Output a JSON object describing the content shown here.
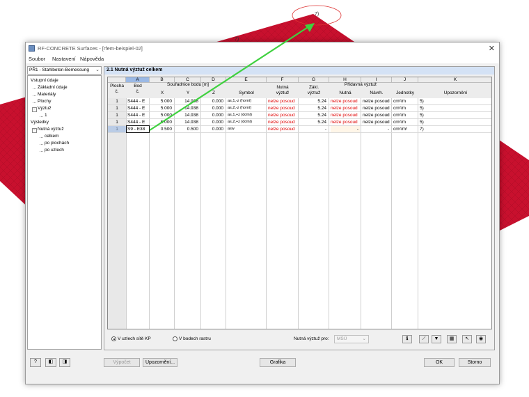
{
  "background": {
    "node_labels": [
      "7)",
      "7)"
    ]
  },
  "window": {
    "title": "RF-CONCRETE Surfaces - [rfem-beispiel-02]",
    "close_glyph": "✕",
    "menu": [
      "Soubor",
      "Nastavení",
      "Nápověda"
    ]
  },
  "case_select": {
    "value": "PŘ1 - Stahlbeton-Bemessung"
  },
  "navigator": {
    "items": [
      {
        "label": "Vstupní údaje",
        "level": 0,
        "toggle": ""
      },
      {
        "label": "Základní údaje",
        "level": 1,
        "toggle": ""
      },
      {
        "label": "Materiály",
        "level": 1,
        "toggle": ""
      },
      {
        "label": "Plochy",
        "level": 1,
        "toggle": ""
      },
      {
        "label": "Výztuž",
        "level": 1,
        "toggle": "−"
      },
      {
        "label": "1",
        "level": 2,
        "toggle": ""
      },
      {
        "label": "Výsledky",
        "level": 0,
        "toggle": ""
      },
      {
        "label": "Nutná výztuž",
        "level": 1,
        "toggle": "−"
      },
      {
        "label": "celkem",
        "level": 2,
        "toggle": ""
      },
      {
        "label": "po plochách",
        "level": 2,
        "toggle": ""
      },
      {
        "label": "po uzlech",
        "level": 2,
        "toggle": ""
      }
    ]
  },
  "panel": {
    "title": "2.1 Nutná výztuž celkem"
  },
  "table": {
    "column_letters": [
      "A",
      "B",
      "C",
      "D",
      "E",
      "F",
      "G",
      "H",
      "I",
      "J",
      "K"
    ],
    "selected_letter": "A",
    "header": {
      "plocha_1": "Plocha",
      "plocha_2": "č.",
      "bod_1": "Bod",
      "bod_2": "č.",
      "coords_group": "Souřadnice bodu [m]",
      "x": "X",
      "y": "Y",
      "z": "Z",
      "symbol": "Symbol",
      "nutna_1": "Nutná",
      "nutna_2": "výztuž",
      "zakl_1": "Zákl.",
      "zakl_2": "výztuž",
      "pridavna_group": "Přídavná výztuž",
      "pridavna_nutna": "Nutná",
      "pridavna_navrh": "Návrh.",
      "jednotky": "Jednotky",
      "upozorneni": "Upozornění"
    },
    "rows": [
      {
        "plocha": "1",
        "bod": "S444 - E",
        "x": "5.000",
        "y": "14.938",
        "z": "0.000",
        "symbol": "as,1,-z (horní)",
        "nutna": "nelze posoud",
        "zakl": "5.24",
        "pnutna": "nelze posoud",
        "navrh": "nelze posoud",
        "unit": "cm²/m",
        "warn": "5)"
      },
      {
        "plocha": "1",
        "bod": "S444 - E",
        "x": "5.000",
        "y": "14.938",
        "z": "0.000",
        "symbol": "as,2,-z (horní)",
        "nutna": "nelze posoud",
        "zakl": "5.24",
        "pnutna": "nelze posoud",
        "navrh": "nelze posoud",
        "unit": "cm²/m",
        "warn": "5)"
      },
      {
        "plocha": "1",
        "bod": "S444 - E",
        "x": "5.000",
        "y": "14.938",
        "z": "0.000",
        "symbol": "as,1,+z (dolní)",
        "nutna": "nelze posoud",
        "zakl": "5.24",
        "pnutna": "nelze posoud",
        "navrh": "nelze posoud",
        "unit": "cm²/m",
        "warn": "5)"
      },
      {
        "plocha": "1",
        "bod": "S444 - E",
        "x": "5.000",
        "y": "14.938",
        "z": "0.000",
        "symbol": "as,2,+z (dolní)",
        "nutna": "nelze posoud",
        "zakl": "5.24",
        "pnutna": "nelze posoud",
        "navrh": "nelze posoud",
        "unit": "cm²/m",
        "warn": "5)"
      },
      {
        "plocha": "1",
        "bod": "S9 - E38",
        "x": "0.500",
        "y": "0.500",
        "z": "0.000",
        "symbol": "asw",
        "nutna": "nelze posoud",
        "zakl": "-",
        "pnutna": "-",
        "navrh": "-",
        "unit": "cm²/m²",
        "warn": "7)"
      }
    ]
  },
  "options": {
    "radio1": "V uzlech sítě KP",
    "radio2": "V bodech rastru",
    "required_for_label": "Nutná výztuž pro:",
    "required_for_value": "MSÚ"
  },
  "buttons": {
    "calc": "Výpočet",
    "warnings": "Upozornění...",
    "graphics": "Grafika",
    "ok": "OK",
    "cancel": "Storno"
  },
  "colors": {
    "surface": "#c8102e",
    "arrow": "#3fd13f",
    "selected_header": "#9bb9e5",
    "error_text": "#e00000"
  },
  "icons": [
    "info-icon",
    "filter-icon",
    "funnel-icon",
    "export-icon",
    "cursor-icon",
    "eye-icon",
    "help-icon",
    "prev-icon",
    "next-icon"
  ]
}
